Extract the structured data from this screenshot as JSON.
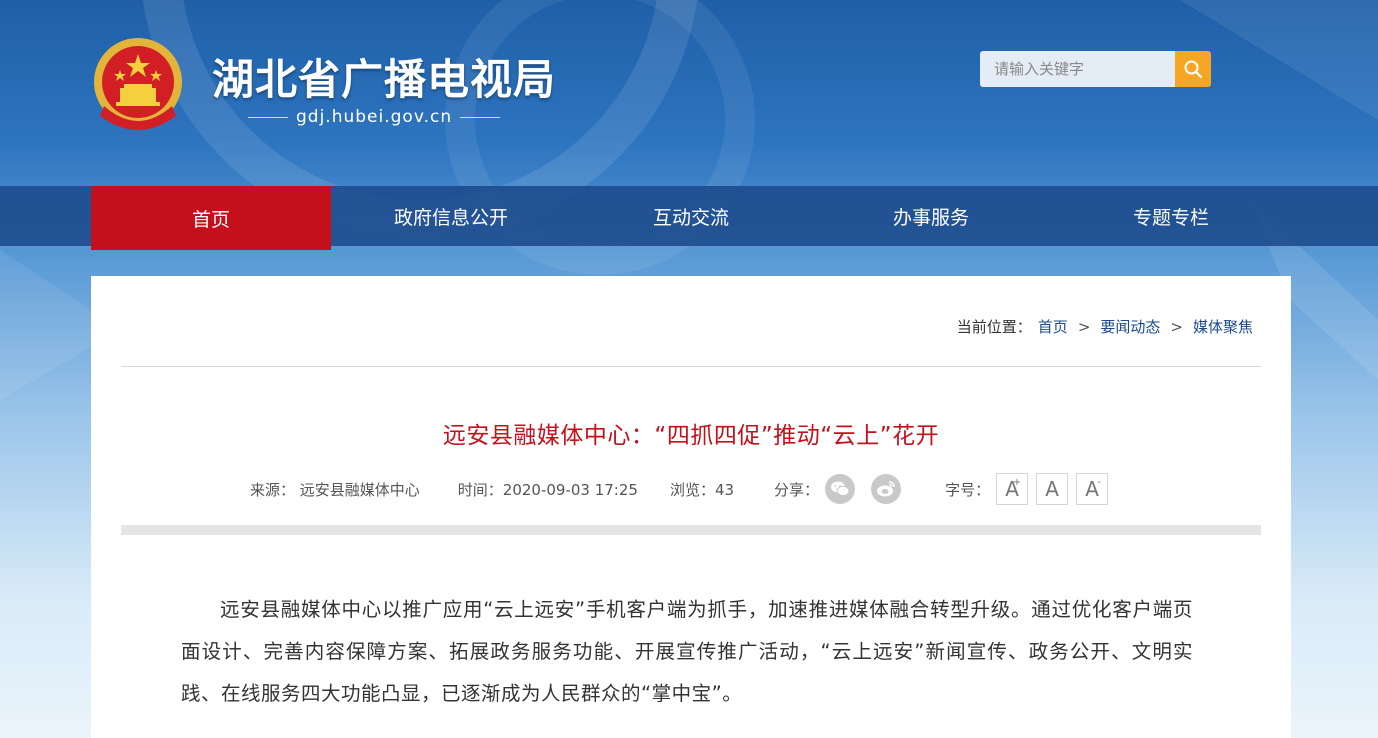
{
  "site": {
    "title": "湖北省广播电视局",
    "url": "gdj.hubei.gov.cn"
  },
  "search": {
    "placeholder": "请输入关键字"
  },
  "nav": {
    "items": [
      {
        "label": "首页",
        "active": true
      },
      {
        "label": "政府信息公开",
        "active": false
      },
      {
        "label": "互动交流",
        "active": false
      },
      {
        "label": "办事服务",
        "active": false
      },
      {
        "label": "专题专栏",
        "active": false
      }
    ]
  },
  "breadcrumb": {
    "prefix": "当前位置：",
    "items": [
      "首页",
      "要闻动态",
      "媒体聚焦"
    ],
    "separator": ">"
  },
  "article": {
    "title": "远安县融媒体中心：“四抓四促”推动“云上”花开",
    "source": "来源：  远安县融媒体中心",
    "time": "时间：2020-09-03 17:25",
    "views": "浏览：43",
    "share_label": "分享：",
    "font_label": "字号：",
    "font_buttons": [
      "A",
      "A",
      "A"
    ],
    "body": "远安县融媒体中心以推广应用“云上远安”手机客户端为抓手，加速推进媒体融合转型升级。通过优化客户端页面设计、完善内容保障方案、拓展政务服务功能、开展宣传推广活动，“云上远安”新闻宣传、政务公开、文明实践、在线服务四大功能凸显，已逐渐成为人民群众的“掌中宝”。"
  },
  "icons": {
    "emblem": "national-emblem-icon",
    "search": "search-icon",
    "share_wechat": "wechat-icon",
    "share_weibo": "weibo-icon"
  },
  "colors": {
    "accent_red": "#c4101b",
    "nav_blue": "#1c4a8c",
    "search_orange": "#f5a623"
  }
}
